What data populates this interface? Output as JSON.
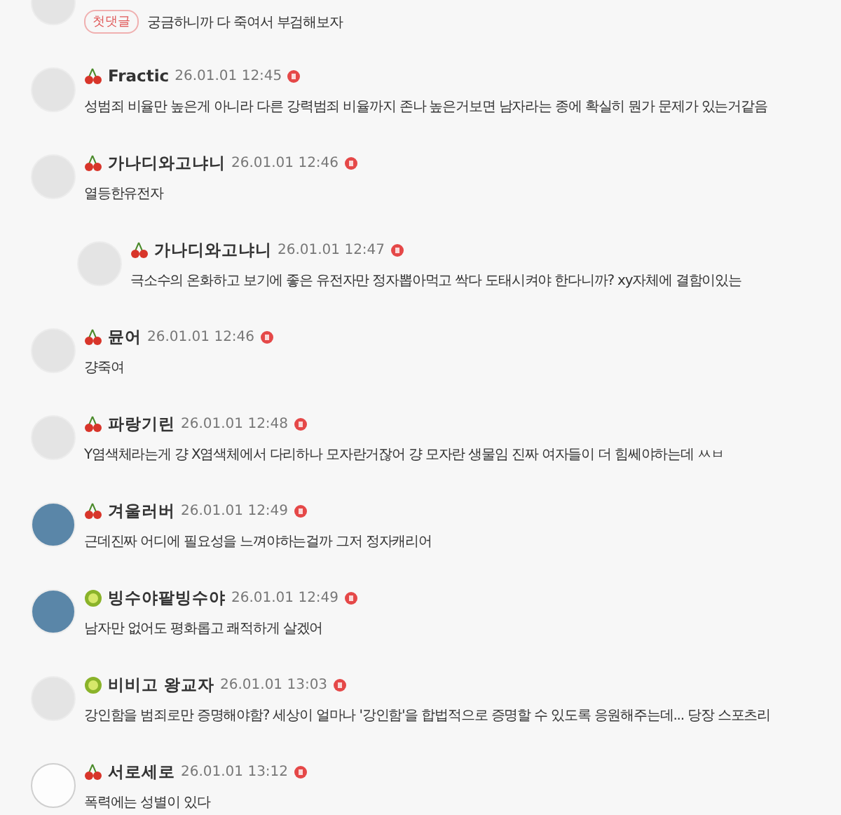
{
  "comments": [
    {
      "avatar": {
        "kind": "default"
      },
      "reply": false,
      "badge": "첫댓글",
      "text": "궁금하니까 다 죽여서 부검해보자"
    },
    {
      "avatar": {
        "kind": "default"
      },
      "reply": false,
      "level_icon": {
        "kind": "cherry"
      },
      "name": "Fractic",
      "time": "26.01.01 12:45",
      "text": "성범죄 비율만 높은게 아니라 다른 강력범죄 비율까지 존나 높은거보면 남자라는 종에 확실히 뭔가 문제가 있는거같음"
    },
    {
      "avatar": {
        "kind": "default"
      },
      "reply": false,
      "level_icon": {
        "kind": "cherry"
      },
      "name": "가나디와고냐니",
      "time": "26.01.01 12:46",
      "text": "열등한유전자"
    },
    {
      "avatar": {
        "kind": "default"
      },
      "reply": true,
      "level_icon": {
        "kind": "cherry"
      },
      "name": "가나디와고냐니",
      "time": "26.01.01 12:47",
      "text": "극소수의 온화하고 보기에 좋은 유전자만 정자뽑아먹고 싹다 도태시켜야 한다니까? xy자체에 결함이있는"
    },
    {
      "avatar": {
        "kind": "default"
      },
      "reply": false,
      "level_icon": {
        "kind": "cherry"
      },
      "name": "뮨어",
      "time": "26.01.01 12:46",
      "text": "걍죽여"
    },
    {
      "avatar": {
        "kind": "default"
      },
      "reply": false,
      "level_icon": {
        "kind": "cherry"
      },
      "name": "파랑기린",
      "time": "26.01.01 12:48",
      "text": "Y염색체라는게 걍 X염색체에서 다리하나 모자란거잖어 걍 모자란 생물임 진짜 여자들이 더 힘쎄야하는데 ㅆㅂ"
    },
    {
      "avatar": {
        "kind": "photo"
      },
      "reply": false,
      "level_icon": {
        "kind": "cherry"
      },
      "name": "겨울러버",
      "time": "26.01.01 12:49",
      "text": "근데진짜 어디에 필요성을 느껴야하는걸까 그저 정자캐리어"
    },
    {
      "avatar": {
        "kind": "photo"
      },
      "reply": false,
      "level_icon": {
        "kind": "kiwi"
      },
      "name": "빙수야팥빙수야",
      "time": "26.01.01 12:49",
      "text": "남자만 없어도 평화롭고 쾌적하게 살겠어"
    },
    {
      "avatar": {
        "kind": "default"
      },
      "reply": false,
      "level_icon": {
        "kind": "kiwi"
      },
      "name": "비비고 왕교자",
      "time": "26.01.01 13:03",
      "text": "강인함을 범죄로만 증명해야함? 세상이 얼마나 '강인함'을 합법적으로 증명할 수 있도록 응원해주는데... 당장 스포츠리"
    },
    {
      "avatar": {
        "kind": "outline"
      },
      "reply": false,
      "level_icon": {
        "kind": "cherry"
      },
      "name": "서로세로",
      "time": "26.01.01 13:12",
      "text": "폭력에는 성별이 있다"
    }
  ]
}
